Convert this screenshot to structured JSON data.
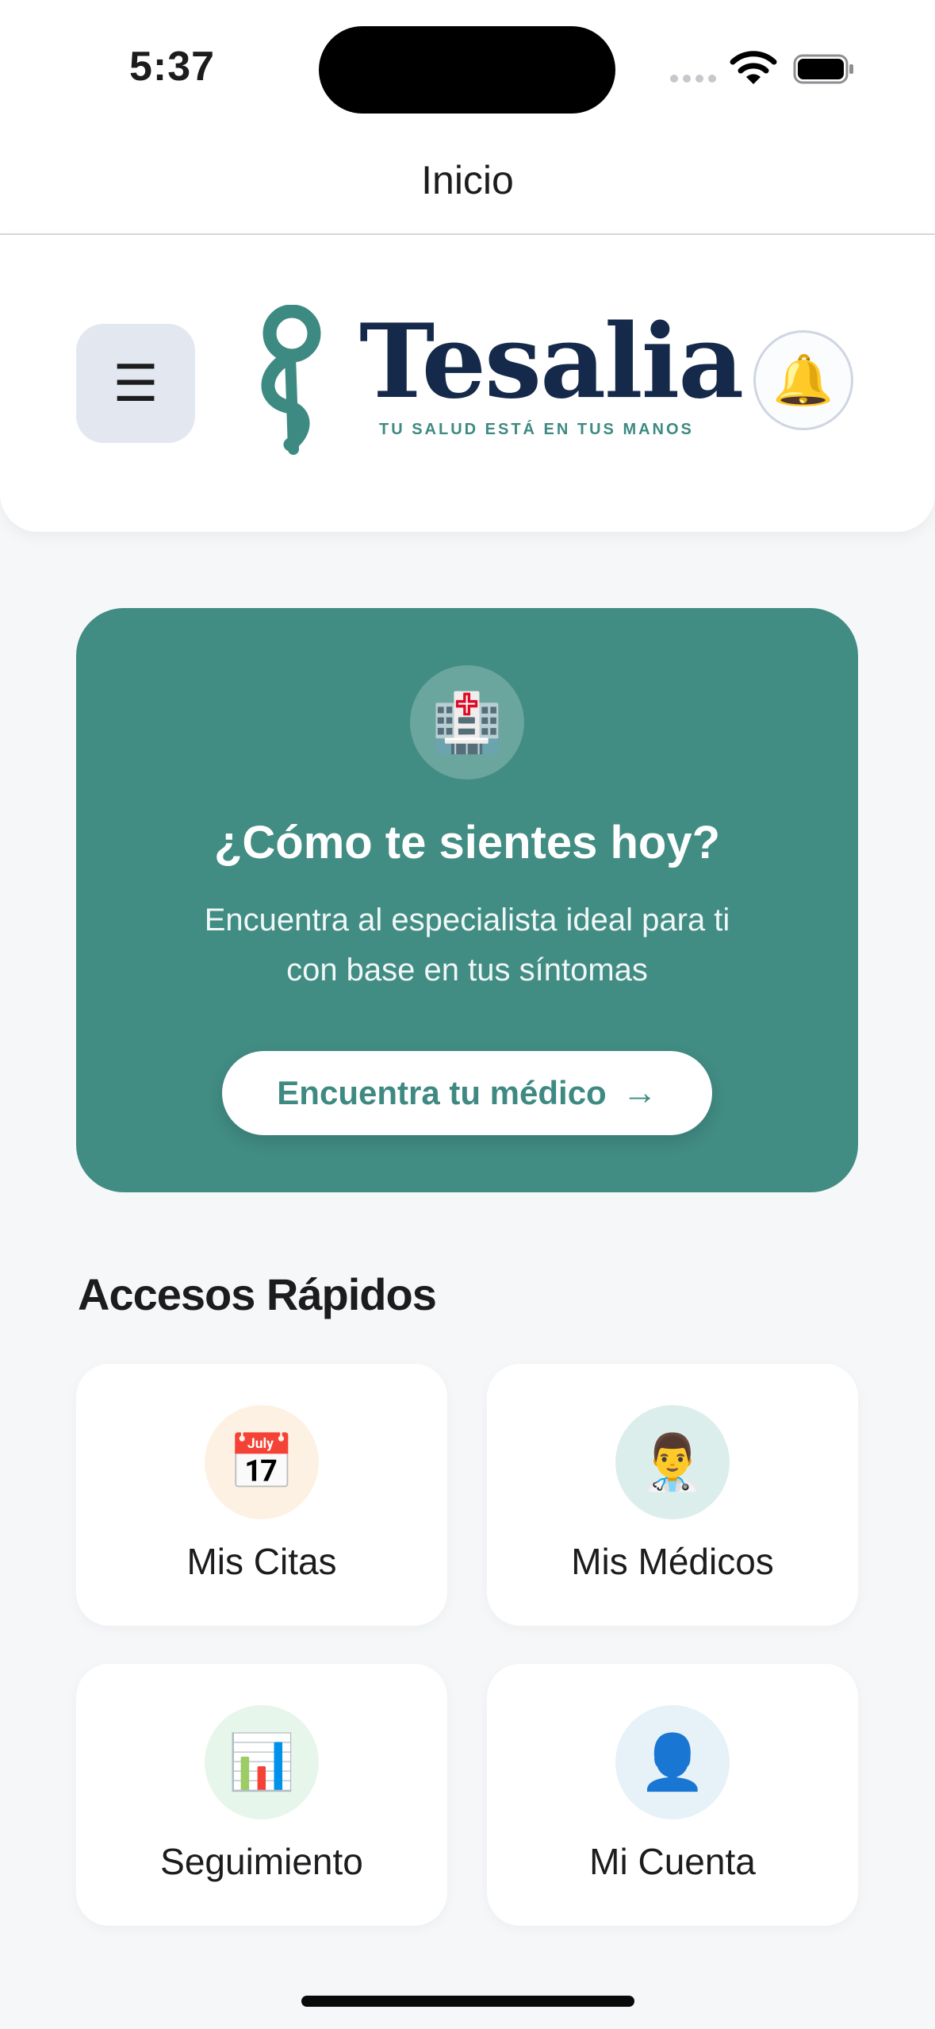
{
  "status_bar": {
    "time": "5:37"
  },
  "nav": {
    "title": "Inicio"
  },
  "header": {
    "logo_name": "Tesalia",
    "logo_tagline": "TU SALUD ESTÁ EN TUS MANOS",
    "menu_glyph": "☰",
    "bell_glyph": "🔔"
  },
  "hero": {
    "icon": "🏥",
    "title": "¿Cómo te sientes hoy?",
    "subtitle_line1": "Encuentra al especialista ideal para ti",
    "subtitle_line2": "con base en tus síntomas",
    "button_label": "Encuentra tu médico",
    "button_arrow": "→"
  },
  "quick_access": {
    "title": "Accesos Rápidos",
    "items": [
      {
        "label": "Mis Citas",
        "icon": "📅",
        "bg": "#fdf1e4"
      },
      {
        "label": "Mis Médicos",
        "icon": "👨‍⚕️",
        "bg": "#dceeeb"
      },
      {
        "label": "Seguimiento",
        "icon": "📊",
        "bg": "#e7f6ea"
      },
      {
        "label": "Mi Cuenta",
        "icon": "👤",
        "bg": "#e6f1f8"
      }
    ]
  },
  "colors": {
    "accent": "#418c83",
    "brand_navy": "#152a4a"
  }
}
